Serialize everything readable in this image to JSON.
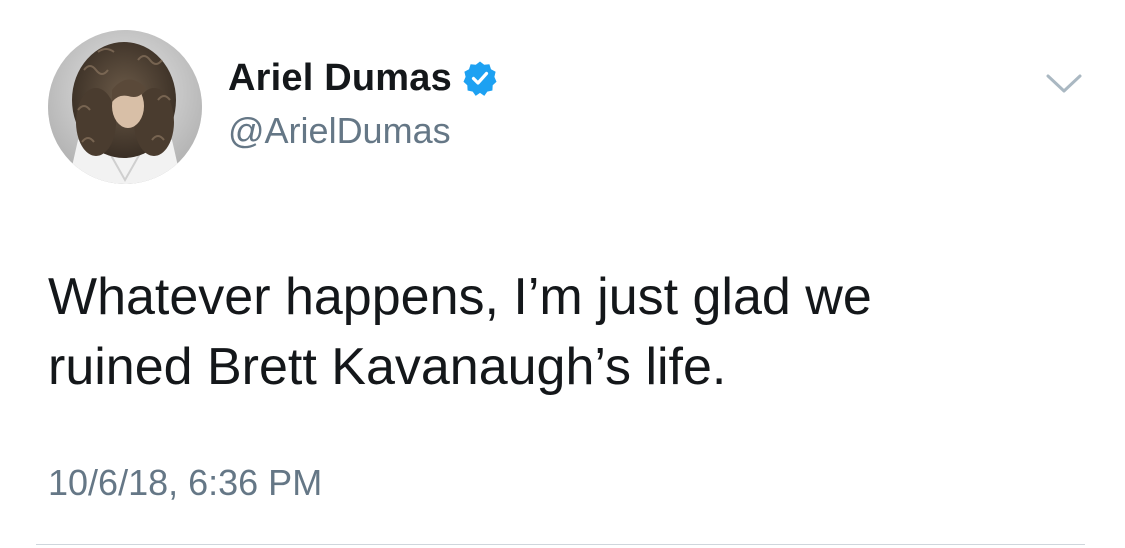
{
  "tweet": {
    "author": {
      "display_name": "Ariel Dumas",
      "handle": "@ArielDumas",
      "verified": true,
      "avatar_icon": "profile-photo"
    },
    "text_lines": [
      "Whatever happens, I’m just glad we",
      "ruined Brett Kavanaugh’s life."
    ],
    "timestamp": "10/6/18, 6:36 PM",
    "menu_icon": "chevron-down-icon"
  },
  "colors": {
    "text_primary": "#14171a",
    "text_secondary": "#657786",
    "verified_badge": "#1da1f2",
    "background": "#ffffff",
    "divider": "#cfd6dc"
  }
}
